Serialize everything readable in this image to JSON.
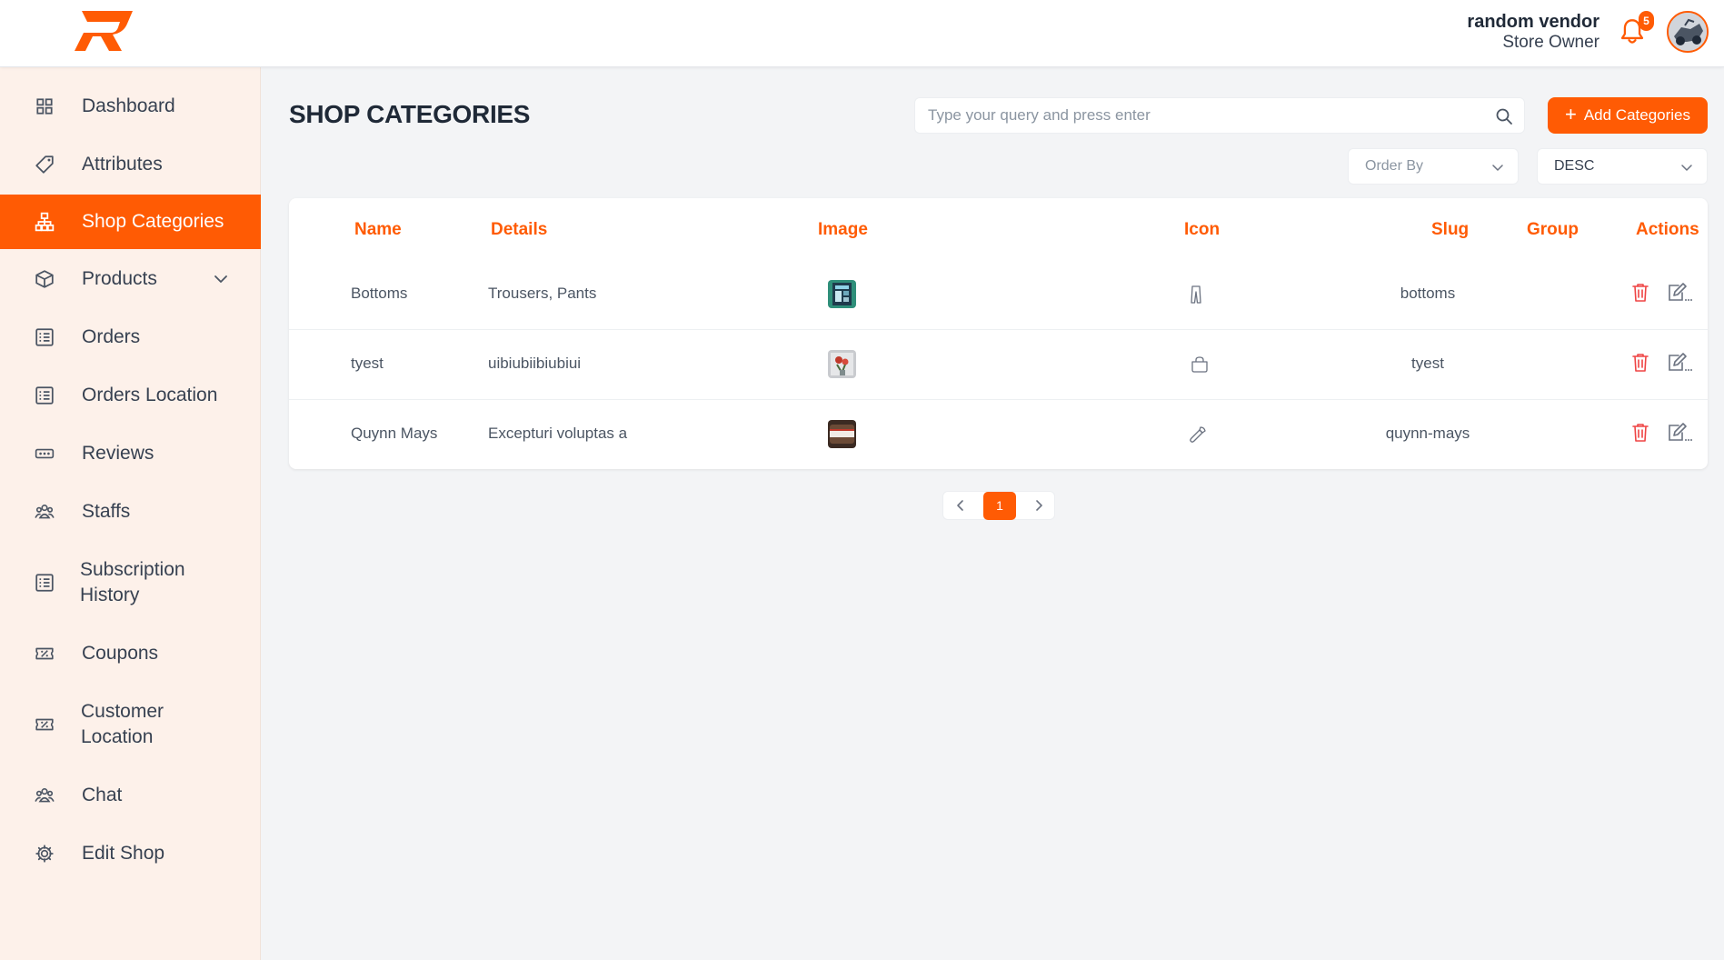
{
  "header": {
    "user_name": "random vendor",
    "user_role": "Store Owner",
    "notification_count": "5"
  },
  "sidebar": {
    "items": [
      {
        "label": "Dashboard",
        "icon": "grid-icon"
      },
      {
        "label": "Attributes",
        "icon": "tag-icon"
      },
      {
        "label": "Shop Categories",
        "icon": "hierarchy-icon",
        "active": true
      },
      {
        "label": "Products",
        "icon": "box-icon",
        "has_submenu": true
      },
      {
        "label": "Orders",
        "icon": "list-icon"
      },
      {
        "label": "Orders Location",
        "icon": "list-icon"
      },
      {
        "label": "Reviews",
        "icon": "rating-icon"
      },
      {
        "label": "Staffs",
        "icon": "users-icon"
      },
      {
        "label": "Subscription History",
        "icon": "list-icon"
      },
      {
        "label": "Coupons",
        "icon": "coupon-icon"
      },
      {
        "label": "Customer Location",
        "icon": "coupon-icon"
      },
      {
        "label": "Chat",
        "icon": "users-icon"
      },
      {
        "label": "Edit Shop",
        "icon": "gear-icon"
      }
    ]
  },
  "main": {
    "title": "SHOP CATEGORIES",
    "search_placeholder": "Type your query and press enter",
    "add_button_label": "Add Categories",
    "order_by_placeholder": "Order By",
    "sort_direction": "DESC"
  },
  "table": {
    "columns": [
      "Name",
      "Details",
      "Image",
      "Icon",
      "Slug",
      "Group",
      "Actions"
    ],
    "rows": [
      {
        "name": "Bottoms",
        "details": "Trousers, Pants",
        "icon": "pants-icon",
        "slug": "bottoms",
        "group": ""
      },
      {
        "name": "tyest",
        "details": "uibiubiibiubiui",
        "icon": "bag-icon",
        "slug": "tyest",
        "group": ""
      },
      {
        "name": "Quynn Mays",
        "details": "Excepturi voluptas a",
        "icon": "tool-icon",
        "slug": "quynn-mays",
        "group": ""
      }
    ]
  },
  "pagination": {
    "current_page": "1"
  },
  "colors": {
    "accent": "#ff5b04",
    "sidebar_bg": "#fdf1ea",
    "page_bg": "#f3f4f6",
    "delete": "#ef4444"
  }
}
